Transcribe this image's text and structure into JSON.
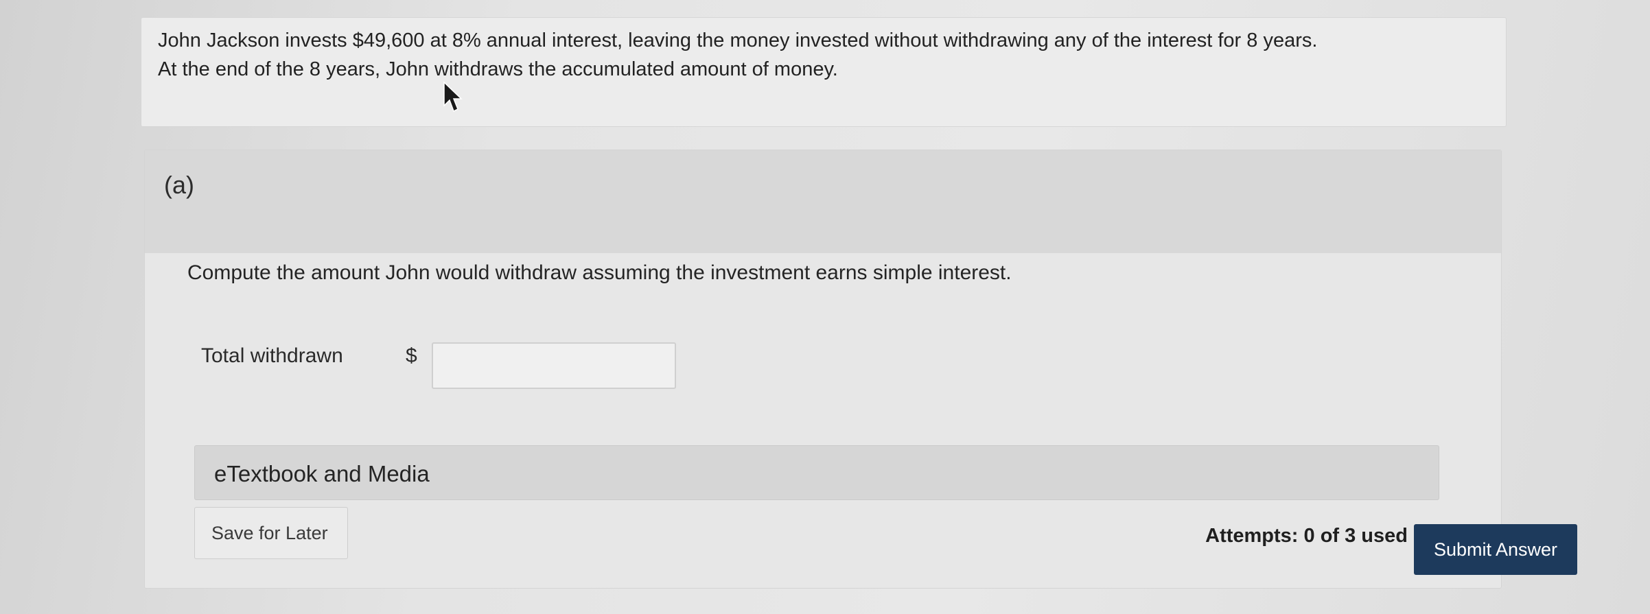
{
  "problem": {
    "line1": "John Jackson invests $49,600 at 8% annual interest, leaving the money invested without withdrawing any of the interest for 8 years.",
    "line2": "At the end of the 8 years, John withdraws the accumulated amount of money."
  },
  "part": {
    "label": "(a)",
    "question": "Compute the amount John would withdraw assuming the investment earns simple interest.",
    "field_label": "Total withdrawn",
    "currency_symbol": "$",
    "input_value": ""
  },
  "etextbook": {
    "label": "eTextbook and Media"
  },
  "actions": {
    "save_label": "Save for Later",
    "attempts_text": "Attempts: 0 of 3 used",
    "submit_label": "Submit Answer"
  },
  "colors": {
    "submit_bg": "#1d3a5c",
    "header_bg": "#d8d8d8"
  },
  "icons": {
    "cursor": "mouse-pointer-icon"
  }
}
